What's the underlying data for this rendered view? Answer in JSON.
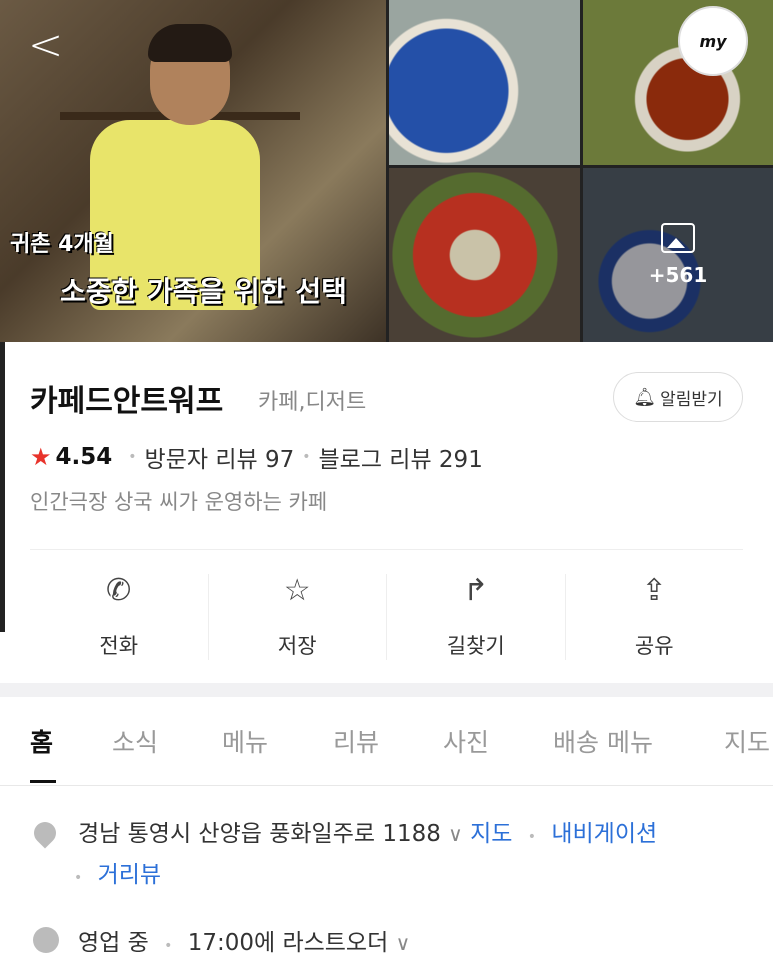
{
  "header": {
    "back_label": "<",
    "my_badge": "my",
    "caption_line1": "귀촌 4개월",
    "caption_line2": "소중한 가족을 위한 선택",
    "photo_more_count": "+561"
  },
  "place": {
    "name": "카페드안트워프",
    "category": "카페,디저트",
    "alarm_label": "알림받기",
    "rating": "4.54",
    "visitor_reviews": "방문자 리뷰 97",
    "blog_reviews": "블로그 리뷰 291",
    "description": "인간극장 상국 씨가 운영하는 카페"
  },
  "actions": [
    {
      "icon": "phone-icon",
      "glyph": "✆",
      "label": "전화"
    },
    {
      "icon": "star-outline-icon",
      "glyph": "☆",
      "label": "저장"
    },
    {
      "icon": "directions-icon",
      "glyph": "↱",
      "label": "길찾기"
    },
    {
      "icon": "share-icon",
      "glyph": "⇪",
      "label": "공유"
    }
  ],
  "tabs": [
    "홈",
    "소식",
    "메뉴",
    "리뷰",
    "사진",
    "배송 메뉴",
    "지도"
  ],
  "info": {
    "address": "경남 통영시 산양읍 풍화일주로 1188",
    "map_link": "지도",
    "navi_link": "내비게이션",
    "street_view_link": "거리뷰",
    "open_status": "영업 중",
    "last_order": "17:00에 라스트오더"
  },
  "colors": {
    "star": "#e8332b",
    "link": "#2c70d8"
  }
}
